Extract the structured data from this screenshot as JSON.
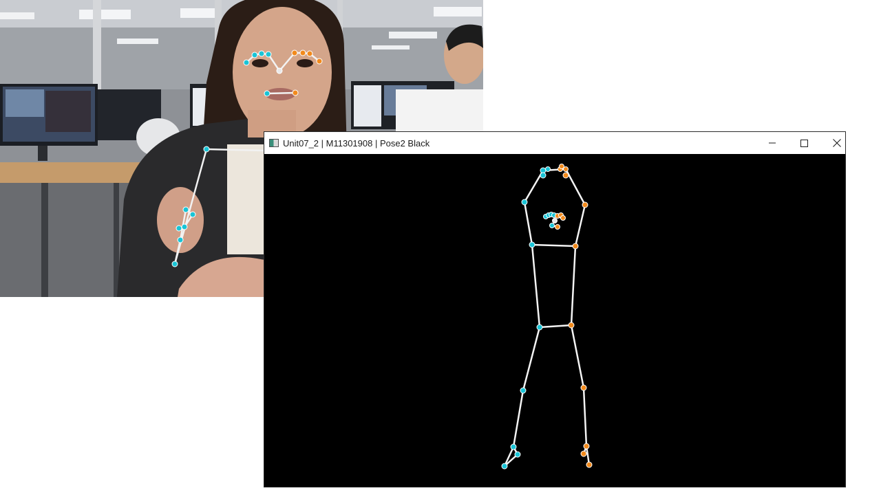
{
  "camera_window": {
    "description_name": "webcam-feed"
  },
  "pose_window": {
    "title": "Unit07_2 | M11301908 | Pose2 Black",
    "buttons": {
      "minimize_icon": "minimize-icon",
      "maximize_icon": "maximize-icon",
      "close_icon": "close-icon"
    }
  },
  "colors": {
    "left_keypoint": "#19c4d6",
    "right_keypoint": "#f28a1c",
    "bone": "#ffffff",
    "canvas_background": "#000000"
  }
}
